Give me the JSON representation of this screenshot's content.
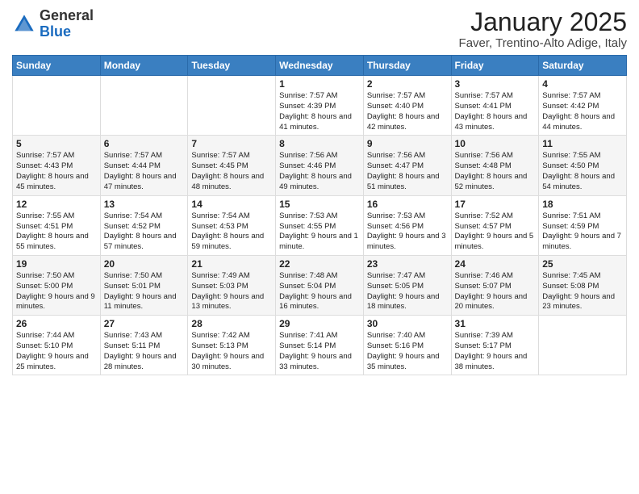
{
  "logo": {
    "general": "General",
    "blue": "Blue"
  },
  "title": "January 2025",
  "subtitle": "Faver, Trentino-Alto Adige, Italy",
  "days_of_week": [
    "Sunday",
    "Monday",
    "Tuesday",
    "Wednesday",
    "Thursday",
    "Friday",
    "Saturday"
  ],
  "weeks": [
    [
      {
        "day": null,
        "info": null
      },
      {
        "day": null,
        "info": null
      },
      {
        "day": null,
        "info": null
      },
      {
        "day": "1",
        "info": "Sunrise: 7:57 AM\nSunset: 4:39 PM\nDaylight: 8 hours and 41 minutes."
      },
      {
        "day": "2",
        "info": "Sunrise: 7:57 AM\nSunset: 4:40 PM\nDaylight: 8 hours and 42 minutes."
      },
      {
        "day": "3",
        "info": "Sunrise: 7:57 AM\nSunset: 4:41 PM\nDaylight: 8 hours and 43 minutes."
      },
      {
        "day": "4",
        "info": "Sunrise: 7:57 AM\nSunset: 4:42 PM\nDaylight: 8 hours and 44 minutes."
      }
    ],
    [
      {
        "day": "5",
        "info": "Sunrise: 7:57 AM\nSunset: 4:43 PM\nDaylight: 8 hours and 45 minutes."
      },
      {
        "day": "6",
        "info": "Sunrise: 7:57 AM\nSunset: 4:44 PM\nDaylight: 8 hours and 47 minutes."
      },
      {
        "day": "7",
        "info": "Sunrise: 7:57 AM\nSunset: 4:45 PM\nDaylight: 8 hours and 48 minutes."
      },
      {
        "day": "8",
        "info": "Sunrise: 7:56 AM\nSunset: 4:46 PM\nDaylight: 8 hours and 49 minutes."
      },
      {
        "day": "9",
        "info": "Sunrise: 7:56 AM\nSunset: 4:47 PM\nDaylight: 8 hours and 51 minutes."
      },
      {
        "day": "10",
        "info": "Sunrise: 7:56 AM\nSunset: 4:48 PM\nDaylight: 8 hours and 52 minutes."
      },
      {
        "day": "11",
        "info": "Sunrise: 7:55 AM\nSunset: 4:50 PM\nDaylight: 8 hours and 54 minutes."
      }
    ],
    [
      {
        "day": "12",
        "info": "Sunrise: 7:55 AM\nSunset: 4:51 PM\nDaylight: 8 hours and 55 minutes."
      },
      {
        "day": "13",
        "info": "Sunrise: 7:54 AM\nSunset: 4:52 PM\nDaylight: 8 hours and 57 minutes."
      },
      {
        "day": "14",
        "info": "Sunrise: 7:54 AM\nSunset: 4:53 PM\nDaylight: 8 hours and 59 minutes."
      },
      {
        "day": "15",
        "info": "Sunrise: 7:53 AM\nSunset: 4:55 PM\nDaylight: 9 hours and 1 minute."
      },
      {
        "day": "16",
        "info": "Sunrise: 7:53 AM\nSunset: 4:56 PM\nDaylight: 9 hours and 3 minutes."
      },
      {
        "day": "17",
        "info": "Sunrise: 7:52 AM\nSunset: 4:57 PM\nDaylight: 9 hours and 5 minutes."
      },
      {
        "day": "18",
        "info": "Sunrise: 7:51 AM\nSunset: 4:59 PM\nDaylight: 9 hours and 7 minutes."
      }
    ],
    [
      {
        "day": "19",
        "info": "Sunrise: 7:50 AM\nSunset: 5:00 PM\nDaylight: 9 hours and 9 minutes."
      },
      {
        "day": "20",
        "info": "Sunrise: 7:50 AM\nSunset: 5:01 PM\nDaylight: 9 hours and 11 minutes."
      },
      {
        "day": "21",
        "info": "Sunrise: 7:49 AM\nSunset: 5:03 PM\nDaylight: 9 hours and 13 minutes."
      },
      {
        "day": "22",
        "info": "Sunrise: 7:48 AM\nSunset: 5:04 PM\nDaylight: 9 hours and 16 minutes."
      },
      {
        "day": "23",
        "info": "Sunrise: 7:47 AM\nSunset: 5:05 PM\nDaylight: 9 hours and 18 minutes."
      },
      {
        "day": "24",
        "info": "Sunrise: 7:46 AM\nSunset: 5:07 PM\nDaylight: 9 hours and 20 minutes."
      },
      {
        "day": "25",
        "info": "Sunrise: 7:45 AM\nSunset: 5:08 PM\nDaylight: 9 hours and 23 minutes."
      }
    ],
    [
      {
        "day": "26",
        "info": "Sunrise: 7:44 AM\nSunset: 5:10 PM\nDaylight: 9 hours and 25 minutes."
      },
      {
        "day": "27",
        "info": "Sunrise: 7:43 AM\nSunset: 5:11 PM\nDaylight: 9 hours and 28 minutes."
      },
      {
        "day": "28",
        "info": "Sunrise: 7:42 AM\nSunset: 5:13 PM\nDaylight: 9 hours and 30 minutes."
      },
      {
        "day": "29",
        "info": "Sunrise: 7:41 AM\nSunset: 5:14 PM\nDaylight: 9 hours and 33 minutes."
      },
      {
        "day": "30",
        "info": "Sunrise: 7:40 AM\nSunset: 5:16 PM\nDaylight: 9 hours and 35 minutes."
      },
      {
        "day": "31",
        "info": "Sunrise: 7:39 AM\nSunset: 5:17 PM\nDaylight: 9 hours and 38 minutes."
      },
      {
        "day": null,
        "info": null
      }
    ]
  ]
}
